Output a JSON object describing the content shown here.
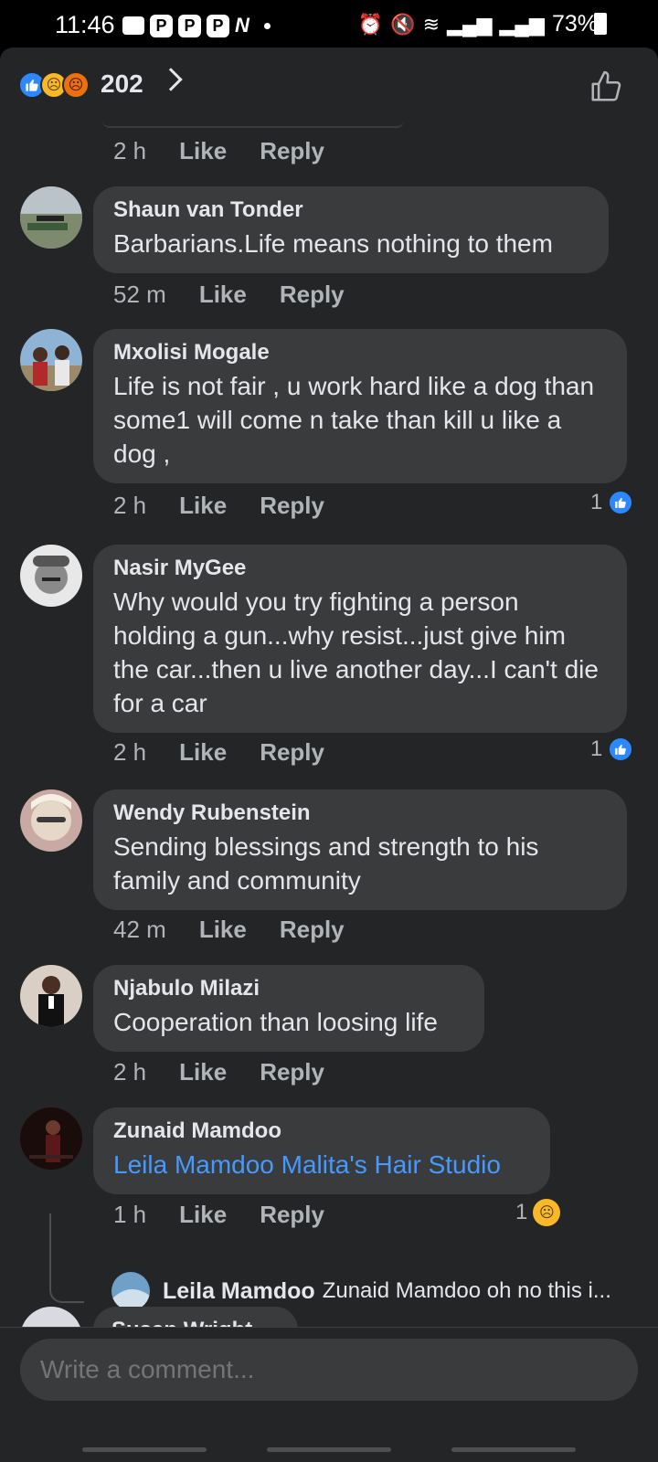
{
  "status_bar": {
    "time": "11:46",
    "notif_icons": [
      "chat-icon",
      "p-app-icon",
      "p-app-icon",
      "p-app-icon",
      "n-app-icon"
    ],
    "battery": "73%"
  },
  "reactions": {
    "count": "202",
    "icons": [
      "like-icon",
      "sad-icon",
      "angry-icon"
    ]
  },
  "top_actions": {
    "time": "2 h",
    "like": "Like",
    "reply": "Reply"
  },
  "comments": [
    {
      "name": "Shaun van Tonder",
      "text": "Barbarians.Life means nothing to them",
      "time": "52 m",
      "like": "Like",
      "reply": "Reply"
    },
    {
      "name": "Mxolisi Mogale",
      "text": "Life is not fair , u work hard like a dog than some1 will come n take than kill u like a dog ,",
      "time": "2 h",
      "like": "Like",
      "reply": "Reply",
      "reaction_count": "1"
    },
    {
      "name": "Nasir MyGee",
      "text": "Why would you try fighting a person holding a gun...why resist...just give him the car...then u live another day...I can't die for a car",
      "time": "2 h",
      "like": "Like",
      "reply": "Reply",
      "reaction_count": "1"
    },
    {
      "name": "Wendy Rubenstein",
      "text": "Sending blessings and strength to his family and community",
      "time": "42 m",
      "like": "Like",
      "reply": "Reply"
    },
    {
      "name": "Njabulo Milazi",
      "text": "Cooperation than loosing life",
      "time": "2 h",
      "like": "Like",
      "reply": "Reply"
    },
    {
      "name": "Zunaid Mamdoo",
      "text": "Leila Mamdoo Malita's Hair Studio",
      "time": "1 h",
      "like": "Like",
      "reply": "Reply",
      "reaction_count": "1"
    }
  ],
  "reply_preview": {
    "name": "Leila Mamdoo",
    "text": "Zunaid Mamdoo oh no this i..."
  },
  "partial_comment": {
    "name": "Susan Wright"
  },
  "composer": {
    "placeholder": "Write a comment..."
  },
  "colors": {
    "background": "#242526",
    "bubble": "#3a3b3c",
    "link": "#4599ff",
    "like_blue": "#2d88ff"
  }
}
